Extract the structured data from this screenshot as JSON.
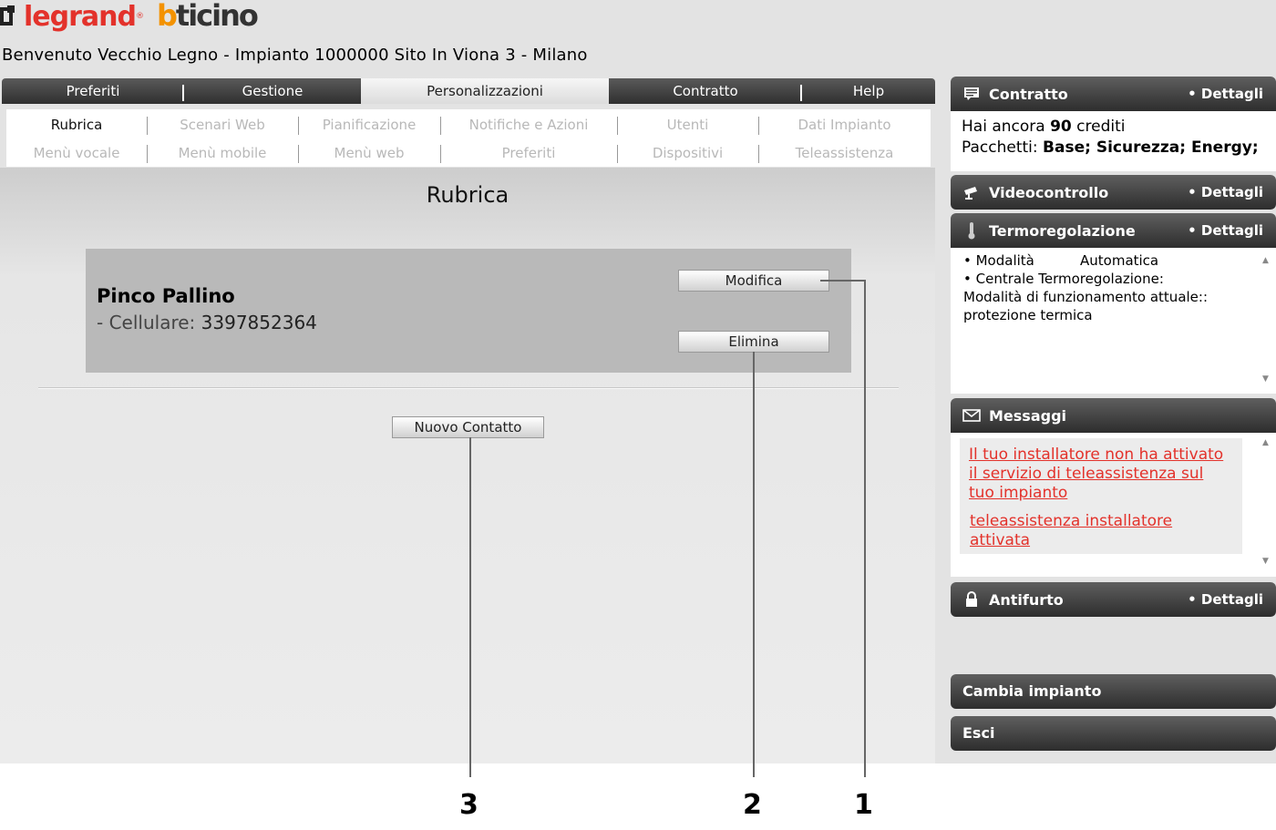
{
  "header": {
    "logo_legrand": "legrand",
    "logo_legrand_reg": "®",
    "logo_bticino_b": "b",
    "logo_bticino_rest": "ticino",
    "welcome": "Benvenuto Vecchio Legno - Impianto 1000000 Sito In Viona 3 - Milano"
  },
  "tabs": [
    {
      "label": "Preferiti",
      "active": false
    },
    {
      "label": "Gestione",
      "active": false
    },
    {
      "label": "Personalizzazioni",
      "active": true
    },
    {
      "label": "Contratto",
      "active": false
    },
    {
      "label": "Help",
      "active": false
    }
  ],
  "subtabs": {
    "row1": [
      "Rubrica",
      "Scenari Web",
      "Pianificazione",
      "Notifiche e Azioni",
      "Utenti",
      "Dati Impianto"
    ],
    "row2": [
      "Menù vocale",
      "Menù mobile",
      "Menù web",
      "Preferiti",
      "Dispositivi",
      "Teleassistenza"
    ],
    "active": "Rubrica"
  },
  "main": {
    "title": "Rubrica",
    "contact": {
      "name": "Pinco Pallino",
      "phone_label": "- Cellulare:",
      "phone_value": "3397852364"
    },
    "edit_button": "Modifica",
    "delete_button": "Elimina",
    "new_contact_button": "Nuovo Contatto"
  },
  "callouts": [
    "1",
    "2",
    "3"
  ],
  "sidebar": {
    "contratto": {
      "title": "Contratto",
      "details": "• Dettagli",
      "credits_prefix": "Hai ancora",
      "credits_value": "90",
      "credits_suffix": "crediti",
      "packages_label": "Pacchetti:",
      "packages_value": "Base; Sicurezza; Energy;"
    },
    "videocontrollo": {
      "title": "Videocontrollo",
      "details": "• Dettagli"
    },
    "termoregolazione": {
      "title": "Termoregolazione",
      "details": "• Dettagli",
      "mode_label": "• Modalità",
      "mode_value": "Automatica",
      "central_label": "• Centrale Termoregolazione:",
      "current_label": "Modalità di funzionamento attuale::",
      "current_value": "protezione termica"
    },
    "messaggi": {
      "title": "Messaggi",
      "items": [
        "Il tuo installatore non ha attivato il servizio di teleassistenza sul tuo impianto",
        "teleassistenza installatore attivata"
      ]
    },
    "antifurto": {
      "title": "Antifurto",
      "details": "• Dettagli"
    },
    "change_plant": "Cambia impianto",
    "exit": "Esci"
  },
  "colors": {
    "brand_red": "#e3322b",
    "brand_orange": "#f39200",
    "header_dark": "#2d2d2d"
  }
}
